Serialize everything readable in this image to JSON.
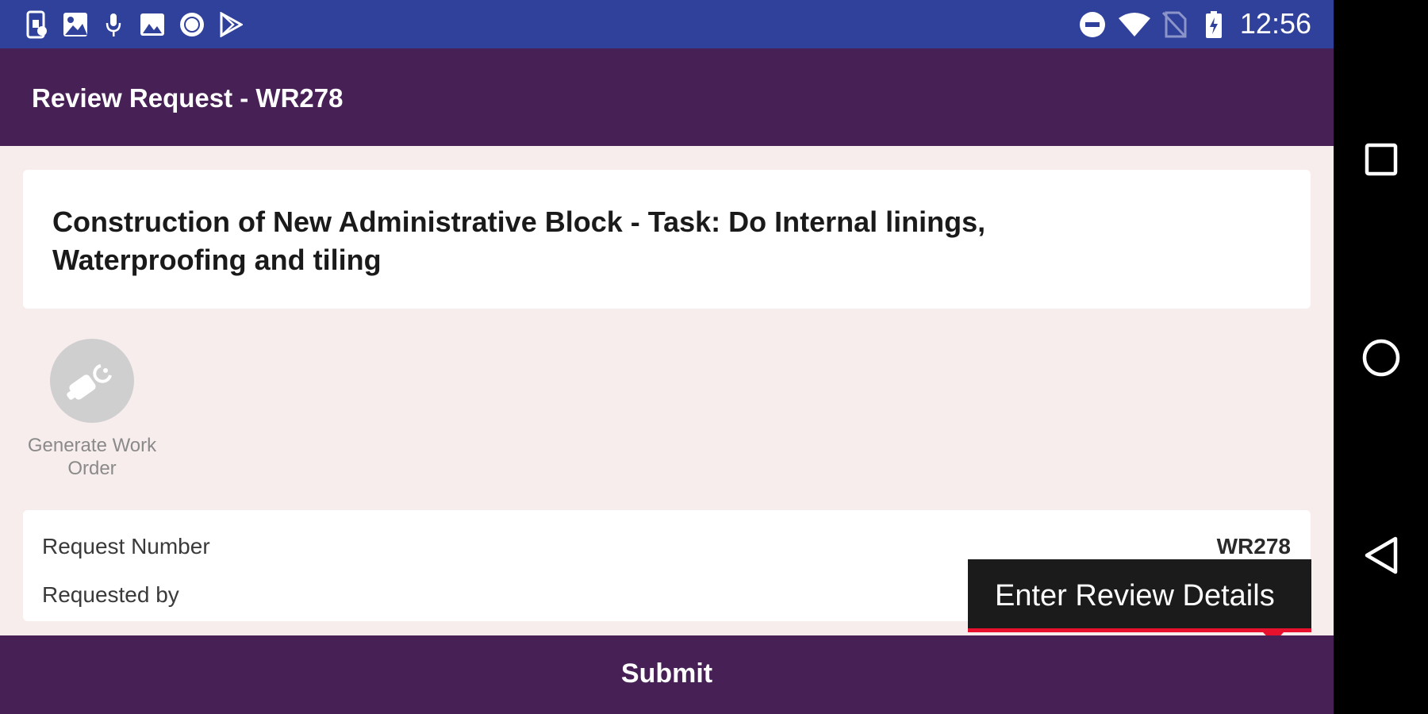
{
  "status_bar": {
    "time": "12:56",
    "left_icons": [
      "phone-data-icon",
      "image-grid-icon",
      "microphone-icon",
      "photo-icon",
      "circle-app-icon",
      "play-store-icon"
    ],
    "right_icons": [
      "do-not-disturb-icon",
      "wifi-icon",
      "no-sim-icon",
      "battery-charging-icon"
    ],
    "background": "#30419b"
  },
  "app_bar": {
    "title": "Review Request - WR278",
    "background": "#472056"
  },
  "request": {
    "title": "Construction of New Administrative Block - Task: Do Internal linings, Waterproofing and tiling"
  },
  "actions": {
    "generate_work_order": {
      "label": "Generate Work Order",
      "icon": "hammer-wrench-icon"
    }
  },
  "details": {
    "rows": [
      {
        "label": "Request Number",
        "value": "WR278"
      },
      {
        "label": "Requested by",
        "value": ""
      }
    ]
  },
  "tooltip": {
    "text": "Enter Review Details",
    "accent": "#e8112d"
  },
  "footer": {
    "submit_label": "Submit"
  },
  "nav_bar": {
    "buttons": [
      "recents-square-icon",
      "home-circle-icon",
      "back-triangle-icon"
    ]
  }
}
